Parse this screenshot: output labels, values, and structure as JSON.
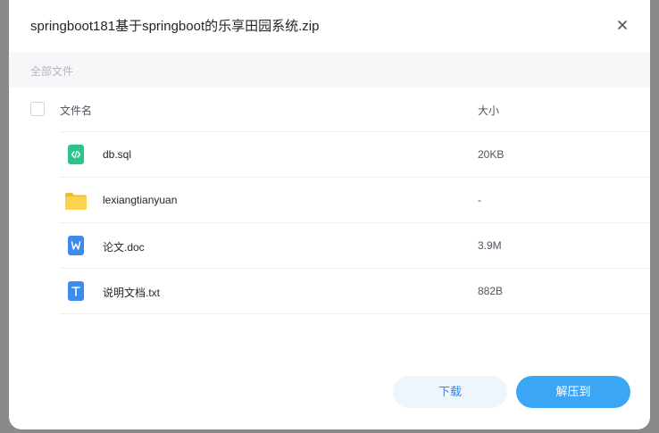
{
  "dialog": {
    "title": "springboot181基于springboot的乐享田园系统.zip"
  },
  "breadcrumb": {
    "label": "全部文件"
  },
  "table": {
    "headers": {
      "name": "文件名",
      "size": "大小"
    },
    "rows": [
      {
        "name": "db.sql",
        "size": "20KB",
        "icon": "sql-file-icon"
      },
      {
        "name": "lexiangtianyuan",
        "size": "-",
        "icon": "folder-icon"
      },
      {
        "name": "论文.doc",
        "size": "3.9M",
        "icon": "word-file-icon"
      },
      {
        "name": "说明文档.txt",
        "size": "882B",
        "icon": "text-file-icon"
      }
    ]
  },
  "actions": {
    "download_label": "下载",
    "extract_label": "解压到"
  },
  "colors": {
    "accent": "#3ba6f6",
    "sql_icon": "#2bc48a",
    "folder_icon": "#fbc93a",
    "doc_icon": "#3c8cf0"
  }
}
